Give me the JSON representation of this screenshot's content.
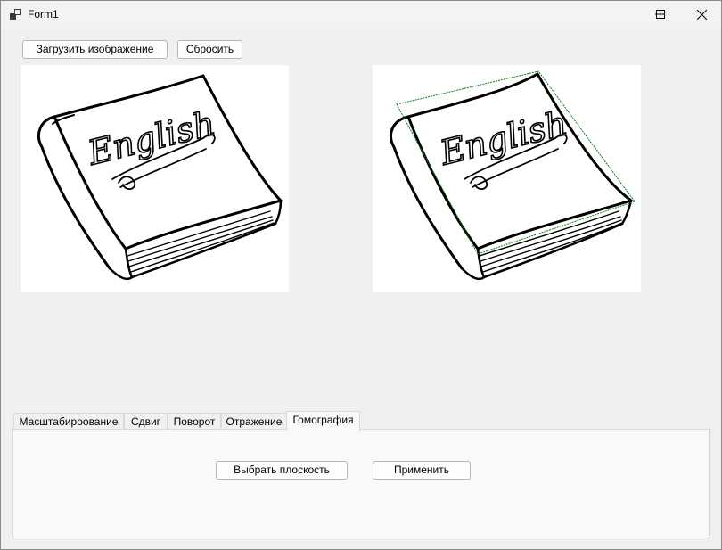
{
  "window": {
    "title": "Form1"
  },
  "toolbar": {
    "load_label": "Загрузить изображение",
    "reset_label": "Сбросить"
  },
  "images": {
    "original_text": "English",
    "result_text": "English"
  },
  "tabs": [
    {
      "label": "Масштабироование",
      "active": false
    },
    {
      "label": "Сдвиг",
      "active": false
    },
    {
      "label": "Поворот",
      "active": false
    },
    {
      "label": "Отражение",
      "active": false
    },
    {
      "label": "Гомография",
      "active": true
    }
  ],
  "homography": {
    "select_plane_label": "Выбрать плоскость",
    "apply_label": "Применить"
  },
  "colors": {
    "selection_outline": "#0a7a1a"
  }
}
